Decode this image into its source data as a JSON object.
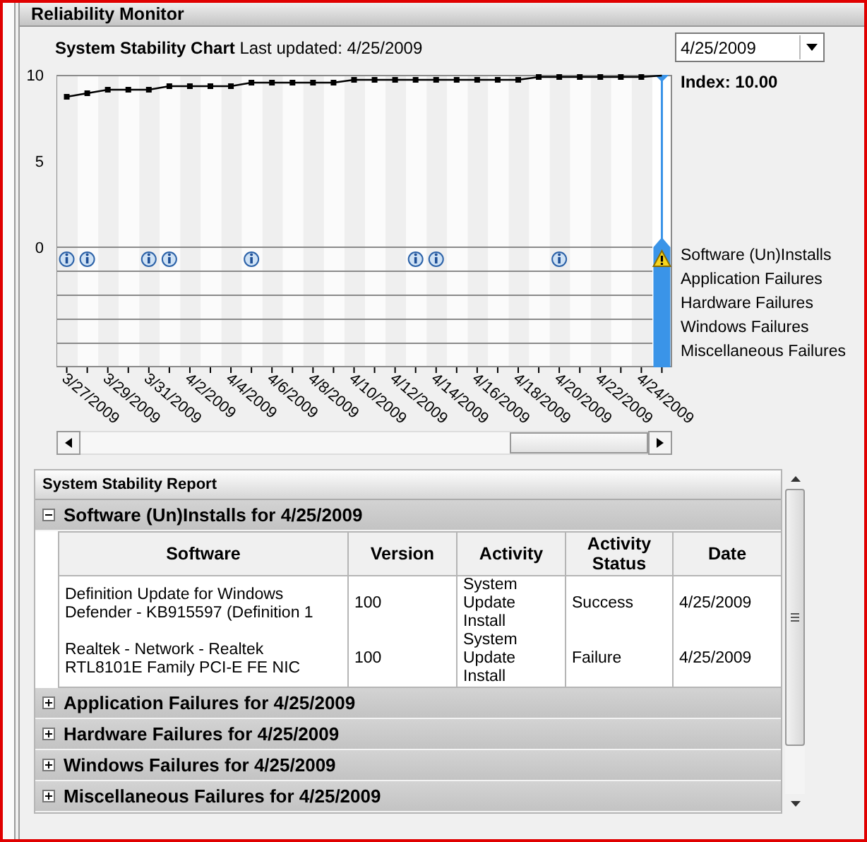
{
  "window": {
    "title": "Reliability Monitor"
  },
  "chart_header": {
    "title": "**System Stability Chart** Last updated: 4/25/2009",
    "date_dropdown": "4/25/2009"
  },
  "chart": {
    "index_label": "Index: 10.00",
    "y_labels": [
      "10",
      "5",
      "0"
    ],
    "x_labels": [
      "3/27/2009",
      "3/29/2009",
      "3/31/2009",
      "4/2/2009",
      "4/4/2009",
      "4/6/2009",
      "4/8/2009",
      "4/10/2009",
      "4/12/2009",
      "4/14/2009",
      "4/16/2009",
      "4/18/2009",
      "4/20/2009",
      "4/22/2009",
      "4/24/2009"
    ],
    "days": [
      {
        "selected": false,
        "kind": "info"
      },
      {
        "selected": false,
        "kind": "info"
      },
      {
        "selected": false,
        "kind": "none"
      },
      {
        "selected": false,
        "kind": "none"
      },
      {
        "selected": false,
        "kind": "info"
      },
      {
        "selected": false,
        "kind": "info"
      },
      {
        "selected": false,
        "kind": "none"
      },
      {
        "selected": false,
        "kind": "none"
      },
      {
        "selected": false,
        "kind": "none"
      },
      {
        "selected": false,
        "kind": "info"
      },
      {
        "selected": false,
        "kind": "none"
      },
      {
        "selected": false,
        "kind": "none"
      },
      {
        "selected": false,
        "kind": "none"
      },
      {
        "selected": false,
        "kind": "none"
      },
      {
        "selected": false,
        "kind": "none"
      },
      {
        "selected": false,
        "kind": "none"
      },
      {
        "selected": false,
        "kind": "none"
      },
      {
        "selected": false,
        "kind": "info"
      },
      {
        "selected": false,
        "kind": "info"
      },
      {
        "selected": false,
        "kind": "none"
      },
      {
        "selected": false,
        "kind": "none"
      },
      {
        "selected": false,
        "kind": "none"
      },
      {
        "selected": false,
        "kind": "none"
      },
      {
        "selected": false,
        "kind": "none"
      },
      {
        "selected": false,
        "kind": "info"
      },
      {
        "selected": false,
        "kind": "none"
      },
      {
        "selected": false,
        "kind": "none"
      },
      {
        "selected": false,
        "kind": "none"
      },
      {
        "selected": false,
        "kind": "none"
      },
      {
        "selected": true,
        "kind": "warning"
      }
    ],
    "event_rows": [
      "Software (Un)Installs",
      "Application Failures",
      "Hardware Failures",
      "Windows Failures",
      "Miscellaneous Failures"
    ]
  },
  "report": {
    "title": "System Stability Report",
    "sections": [
      {
        "title": "Software (Un)Installs for 4/25/2009",
        "expanded": true,
        "columns": [
          "Software",
          "Version",
          "Activity",
          "Activity Status",
          "Date"
        ],
        "rows": [
          [
            "Definition Update for Windows Defender - KB915597 (Definition 1",
            "100",
            "System Update Install",
            "Success",
            "4/25/2009"
          ],
          [
            "Realtek - Network - Realtek RTL8101E Family PCI-E FE NIC",
            "100",
            "System Update Install",
            "Failure",
            "4/25/2009"
          ]
        ]
      },
      {
        "title": "Application Failures for 4/25/2009",
        "expanded": false
      },
      {
        "title": "Hardware Failures for 4/25/2009",
        "expanded": false
      },
      {
        "title": "Windows Failures for 4/25/2009",
        "expanded": false
      },
      {
        "title": "Miscellaneous Failures for 4/25/2009",
        "expanded": false
      }
    ]
  }
}
